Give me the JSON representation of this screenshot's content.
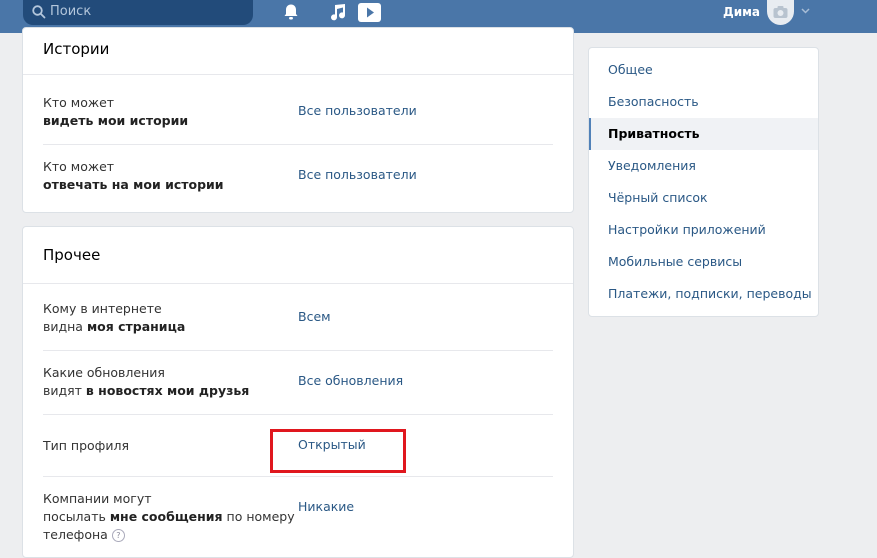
{
  "header": {
    "search_placeholder": "Поиск",
    "user_name": "Дима",
    "icons": [
      "search-icon",
      "bell-icon",
      "music-icon",
      "play-icon",
      "camera-icon",
      "chevron-down-icon"
    ],
    "accent_color": "#4a76a8"
  },
  "stories": {
    "title": "Истории",
    "rows": [
      {
        "label_line1": "Кто может",
        "label_bold": "видеть мои истории",
        "value": "Все пользователи"
      },
      {
        "label_line1": "Кто может",
        "label_bold": "отвечать на мои истории",
        "value": "Все пользователи"
      }
    ]
  },
  "other": {
    "title": "Прочее",
    "rows": [
      {
        "label_line1": "Кому в интернете",
        "label_pre": "видна ",
        "label_bold": "моя страница",
        "value": "Всем"
      },
      {
        "label_line1": "Какие обновления",
        "label_pre": "видят ",
        "label_bold": "в новостях мои друзья",
        "value": "Все обновления"
      },
      {
        "label_line1": "Тип профиля",
        "value": "Открытый"
      },
      {
        "label_line1": "Компании могут",
        "label_pre": "посылать ",
        "label_bold": "мне сообщения",
        "label_post": " по номеру",
        "label_line3": "телефона",
        "value": "Никакие"
      }
    ]
  },
  "settings_menu": {
    "items": [
      {
        "label": "Общее"
      },
      {
        "label": "Безопасность"
      },
      {
        "label": "Приватность"
      },
      {
        "label": "Уведомления"
      },
      {
        "label": "Чёрный список"
      },
      {
        "label": "Настройки приложений"
      },
      {
        "label": "Мобильные сервисы"
      },
      {
        "label": "Платежи, подписки, переводы"
      }
    ],
    "active": "Приватность"
  },
  "highlight_color": "#e0171e"
}
